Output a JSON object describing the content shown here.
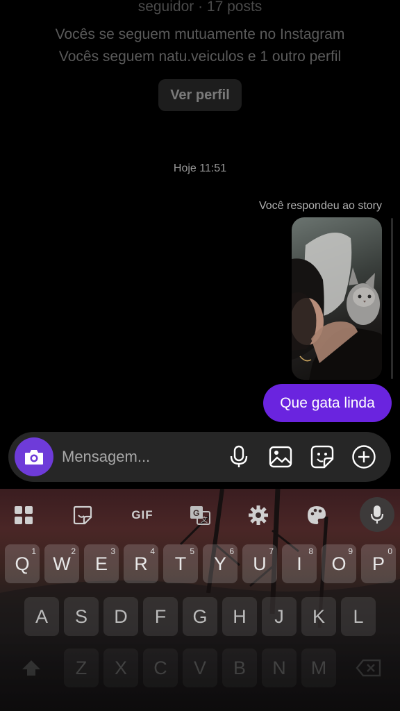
{
  "profile": {
    "followers_line": "seguidor · 17 posts",
    "mutual_line": "Vocês se seguem mutuamente no Instagram",
    "common_line": "Vocês seguem natu.veiculos e 1 outro perfil",
    "view_profile_label": "Ver perfil"
  },
  "conversation": {
    "timestamp": "Hoje 11:51",
    "story_reply_note": "Você respondeu ao story",
    "message_text": "Que gata linda"
  },
  "composer": {
    "placeholder": "Mensagem...",
    "icons": [
      "camera-icon",
      "microphone-icon",
      "gallery-icon",
      "sticker-icon",
      "plus-circle-icon"
    ],
    "camera_color": "#6e3bd9"
  },
  "keyboard": {
    "toolbar": {
      "gif_label": "GIF",
      "icons": [
        "apps-grid-icon",
        "sticker-icon",
        "gif-icon",
        "translate-icon",
        "settings-gear-icon",
        "palette-icon",
        "microphone-icon"
      ]
    },
    "row1": [
      {
        "k": "Q",
        "sup": "1"
      },
      {
        "k": "W",
        "sup": "2"
      },
      {
        "k": "E",
        "sup": "3"
      },
      {
        "k": "R",
        "sup": "4"
      },
      {
        "k": "T",
        "sup": "5"
      },
      {
        "k": "Y",
        "sup": "6"
      },
      {
        "k": "U",
        "sup": "7"
      },
      {
        "k": "I",
        "sup": "8"
      },
      {
        "k": "O",
        "sup": "9"
      },
      {
        "k": "P",
        "sup": "0"
      }
    ],
    "row2": [
      "A",
      "S",
      "D",
      "F",
      "G",
      "H",
      "J",
      "K",
      "L"
    ],
    "row3": [
      "Z",
      "X",
      "C",
      "V",
      "B",
      "N",
      "M"
    ]
  },
  "colors": {
    "message_bubble": "#6a24df",
    "composer_bg": "#262626",
    "background": "#000000"
  }
}
